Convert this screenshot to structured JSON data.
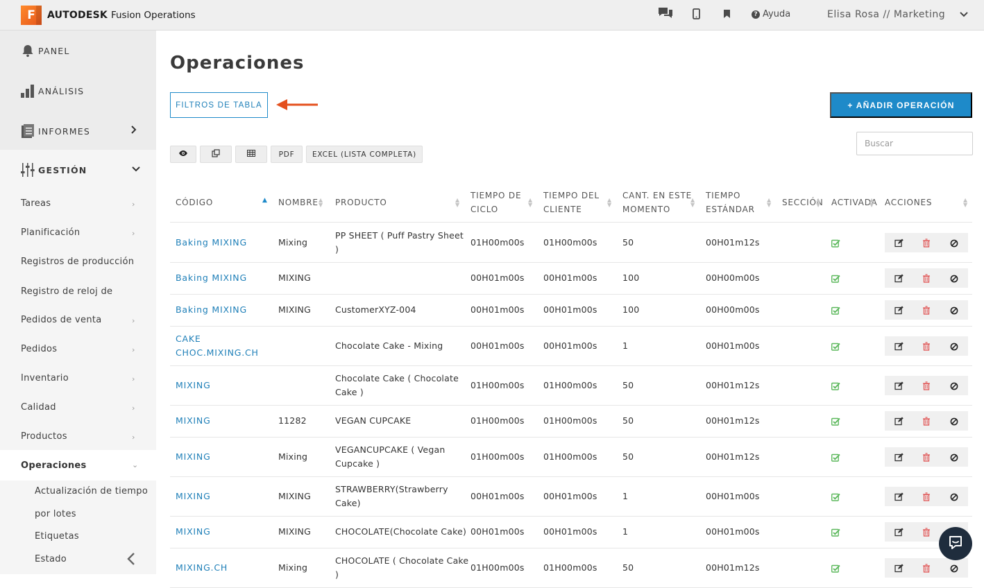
{
  "topbar": {
    "logo_letter": "F",
    "brand": "AUTODESK",
    "product": "Fusion Operations",
    "help_label": "Ayuda",
    "user_name": "Elisa Rosa",
    "user_sep": "//",
    "user_dept": "Marketing"
  },
  "sidebar": {
    "main": [
      {
        "label": "PANEL"
      },
      {
        "label": "ANÁLISIS"
      },
      {
        "label": "INFORMES"
      },
      {
        "label": "GESTIÓN"
      }
    ],
    "sub": [
      "Tareas",
      "Planificación",
      "Registros de producción",
      "Registro de reloj de perforación",
      "Pedidos de venta",
      "Pedidos",
      "Inventario",
      "Calidad",
      "Productos",
      "Operaciones"
    ],
    "sub2": [
      "Actualización de tiempo",
      "por lotes",
      "Etiquetas",
      "Estado"
    ]
  },
  "main": {
    "title": "Operaciones",
    "filters_label": "FILTROS DE TABLA",
    "add_label": "+ AÑADIR OPERACIÓN",
    "search_placeholder": "Buscar",
    "tools": {
      "pdf": "PDF",
      "excel": "EXCEL (LISTA COMPLETA)"
    }
  },
  "table": {
    "headers": {
      "code": "CÓDIGO",
      "name": "NOMBRE",
      "product": "PRODUCTO",
      "cycle_1": "TIEMPO DE",
      "cycle_2": "CICLO",
      "client_1": "TIEMPO DEL",
      "client_2": "CLIENTE",
      "qty_1": "CANT. EN ESTE",
      "qty_2": "MOMENTO",
      "std_1": "TIEMPO",
      "std_2": "ESTÁNDAR",
      "section": "SECCIÓN",
      "active": "ACTIVADA",
      "actions": "ACCIONES"
    },
    "rows": [
      {
        "code1": "Baking MIXING",
        "code2": "",
        "name": "Mixing",
        "prod1": "PP SHEET ( Puff Pastry Sheet",
        "prod2": ")",
        "cycle": "01H00m00s",
        "client": "01H00m00s",
        "qty": "50",
        "std": "00H01m12s"
      },
      {
        "code1": "Baking MIXING",
        "code2": "",
        "name": "MIXING",
        "prod1": "",
        "prod2": "",
        "cycle": "00H01m00s",
        "client": "00H01m00s",
        "qty": "100",
        "std": "00H00m00s"
      },
      {
        "code1": "Baking MIXING",
        "code2": "",
        "name": "MIXING",
        "prod1": "CustomerXYZ-004",
        "prod2": "",
        "cycle": "00H01m00s",
        "client": "00H01m00s",
        "qty": "100",
        "std": "00H00m00s"
      },
      {
        "code1": "CAKE",
        "code2": "CHOC.MIXING.CH",
        "name": "",
        "prod1": "Chocolate Cake - Mixing",
        "prod2": "",
        "cycle": "00H01m00s",
        "client": "00H01m00s",
        "qty": "1",
        "std": "00H01m00s"
      },
      {
        "code1": "MIXING",
        "code2": "",
        "name": "",
        "prod1": "Chocolate Cake ( Chocolate",
        "prod2": "Cake )",
        "cycle": "01H00m00s",
        "client": "01H00m00s",
        "qty": "50",
        "std": "00H01m12s"
      },
      {
        "code1": "MIXING",
        "code2": "",
        "name": "11282",
        "prod1": "VEGAN CUPCAKE",
        "prod2": "",
        "cycle": "01H00m00s",
        "client": "01H00m00s",
        "qty": "50",
        "std": "00H01m12s"
      },
      {
        "code1": "MIXING",
        "code2": "",
        "name": "Mixing",
        "prod1": "VEGANCUPCAKE ( Vegan",
        "prod2": "Cupcake )",
        "cycle": "01H00m00s",
        "client": "01H00m00s",
        "qty": "50",
        "std": "00H01m12s"
      },
      {
        "code1": "MIXING",
        "code2": "",
        "name": "MIXING",
        "prod1": "STRAWBERRY(Strawberry",
        "prod2": "Cake)",
        "cycle": "00H01m00s",
        "client": "00H01m00s",
        "qty": "1",
        "std": "00H01m00s"
      },
      {
        "code1": "MIXING",
        "code2": "",
        "name": "MIXING",
        "prod1": "CHOCOLATE(Chocolate Cake)",
        "prod2": "",
        "cycle": "00H01m00s",
        "client": "00H01m00s",
        "qty": "1",
        "std": "00H01m00s"
      },
      {
        "code1": "MIXING.CH",
        "code2": "",
        "name": "Mixing",
        "prod1": "CHOCOLATE ( Chocolate Cake",
        "prod2": ")",
        "cycle": "01H00m00s",
        "client": "01H00m00s",
        "qty": "50",
        "std": "00H01m12s"
      }
    ]
  },
  "colors": {
    "accent": "#1e8ac9",
    "check": "#5cb85c",
    "delete": "#e05555",
    "arrow": "#e4501e"
  }
}
